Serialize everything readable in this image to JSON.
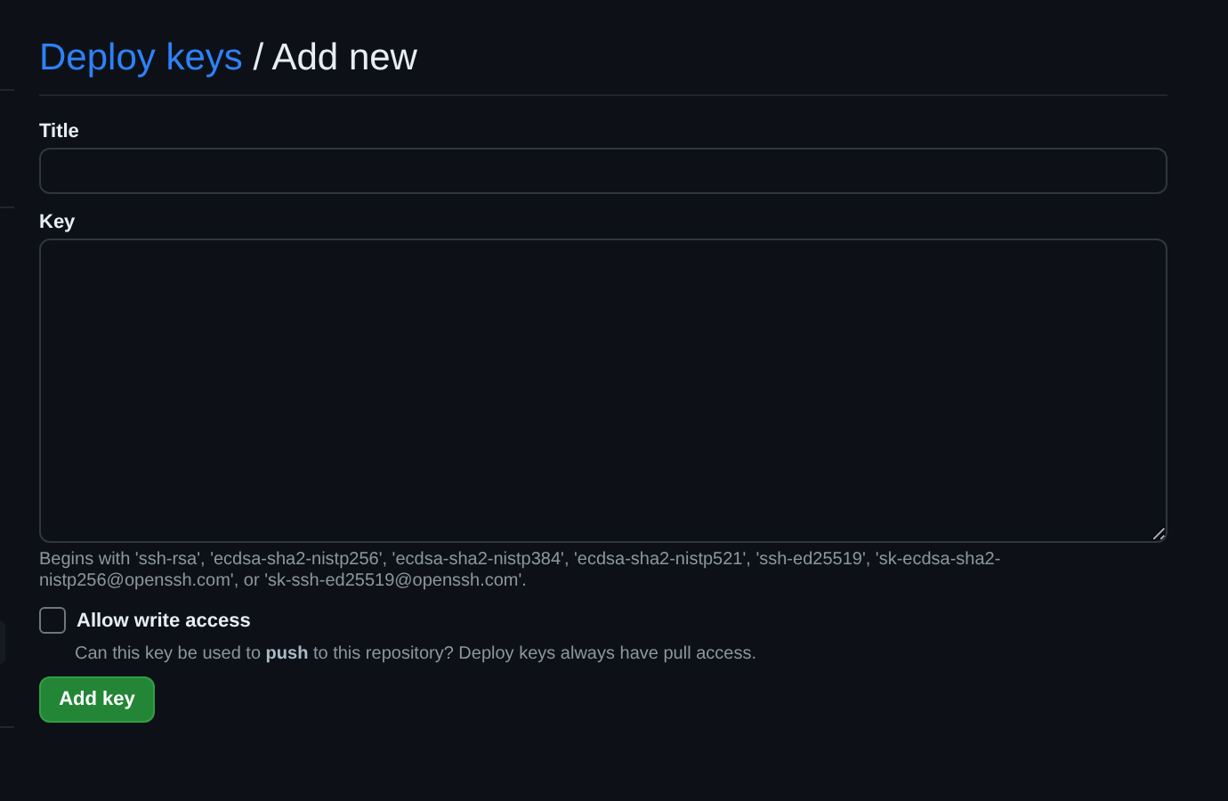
{
  "heading": {
    "link": "Deploy keys",
    "title": "/ Add new"
  },
  "fields": [
    {
      "label": "Title",
      "kind": "input"
    },
    {
      "label": "Key",
      "kind": "textarea"
    }
  ],
  "key_hint": "Begins with 'ssh-rsa', 'ecdsa-sha2-nistp256', 'ecdsa-sha2-nistp384', 'ecdsa-sha2-nistp521', 'ssh-ed25519', 'sk-ecdsa-sha2-nistp256@openssh.com', or 'sk-ssh-ed25519@openssh.com'.",
  "write_access": {
    "label": "Allow write access",
    "checked": false,
    "description": "Can this key be used to **push** to this repository? Deploy keys always have pull access."
  },
  "submit": "Add key"
}
